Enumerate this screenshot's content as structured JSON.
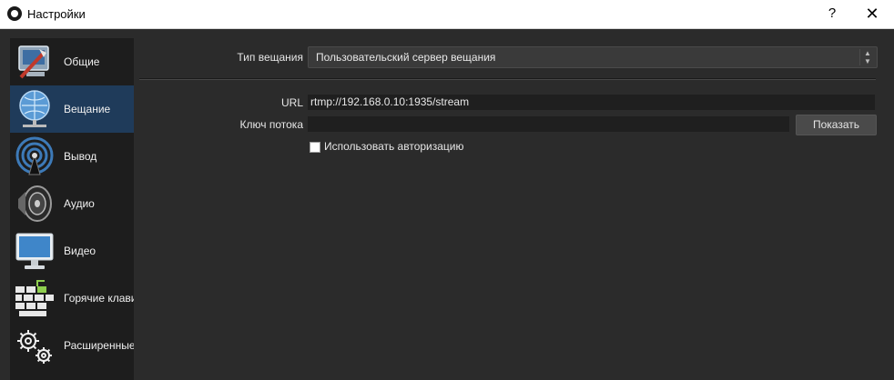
{
  "window": {
    "title": "Настройки",
    "help": "?",
    "close": "✕"
  },
  "sidebar": {
    "items": [
      {
        "label": "Общие",
        "icon": "general-settings-icon",
        "active": false
      },
      {
        "label": "Вещание",
        "icon": "globe-network-icon",
        "active": true
      },
      {
        "label": "Вывод",
        "icon": "broadcast-antenna-icon",
        "active": false
      },
      {
        "label": "Аудио",
        "icon": "speaker-icon",
        "active": false
      },
      {
        "label": "Видео",
        "icon": "monitor-icon",
        "active": false
      },
      {
        "label": "Горячие клави",
        "icon": "keyboard-icon",
        "active": false
      },
      {
        "label": "Расширенные",
        "icon": "gears-icon",
        "active": false
      }
    ]
  },
  "stream": {
    "type_label": "Тип вещания",
    "type_value": "Пользовательский сервер вещания",
    "url_label": "URL",
    "url_value": "rtmp://192.168.0.10:1935/stream",
    "key_label": "Ключ потока",
    "key_value": "",
    "show_button": "Показать",
    "auth_label": "Использовать авторизацию",
    "auth_checked": false
  },
  "colors": {
    "active_item": "#1f3b5a",
    "panel_bg": "#2b2b2b",
    "sidebar_bg": "#1d1d1d"
  }
}
